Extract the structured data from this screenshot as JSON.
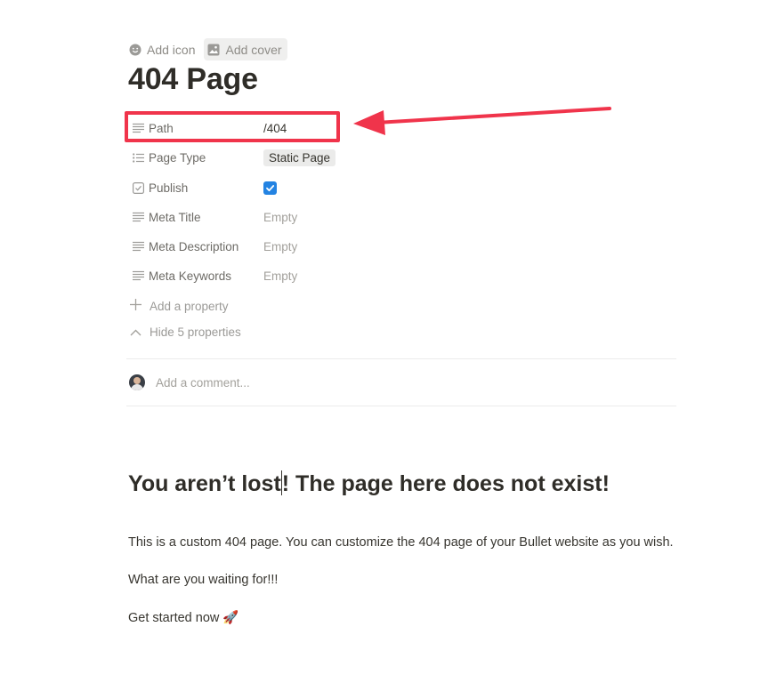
{
  "page_actions": {
    "add_icon": "Add icon",
    "add_cover": "Add cover"
  },
  "title": "404 Page",
  "properties": [
    {
      "name": "Path",
      "icon": "text-lines-icon",
      "value": "/404"
    },
    {
      "name": "Page Type",
      "icon": "list-icon",
      "value": "Static Page"
    },
    {
      "name": "Publish",
      "icon": "checkbox-icon",
      "value": true
    },
    {
      "name": "Meta Title",
      "icon": "text-lines-icon",
      "value": "Empty"
    },
    {
      "name": "Meta Description",
      "icon": "text-lines-icon",
      "value": "Empty"
    },
    {
      "name": "Meta Keywords",
      "icon": "text-lines-icon",
      "value": "Empty"
    }
  ],
  "add_property": "Add a property",
  "hide_properties": "Hide 5 properties",
  "comment": {
    "placeholder": "Add a comment..."
  },
  "content": {
    "heading_part1": "You aren’t lost",
    "heading_part2": "! The page here does not exist!",
    "paragraph1": "This is a custom 404 page. You can customize the 404 page of your Bullet website as you wish.",
    "paragraph2": "What are you waiting for!!!",
    "paragraph3": "Get started now",
    "paragraph3_emoji": "🚀"
  },
  "colors": {
    "highlight": "#f0344b",
    "checkbox": "#2383e2"
  }
}
